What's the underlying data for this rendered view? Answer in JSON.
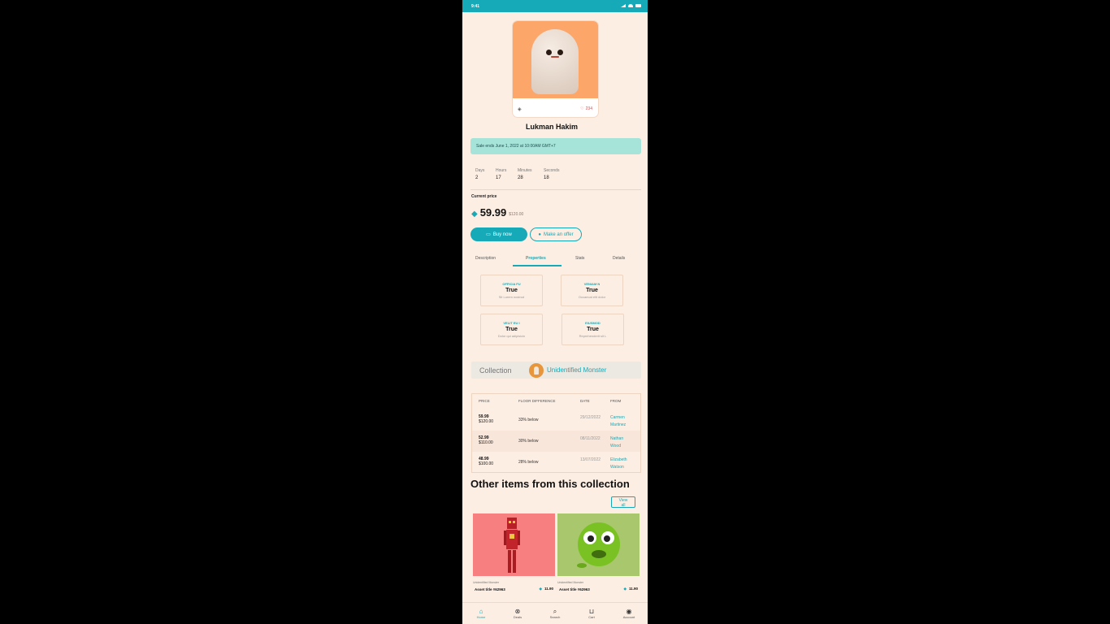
{
  "status_bar": {
    "time": "9:41"
  },
  "item": {
    "likes": "234",
    "name": "Lukman Hakim"
  },
  "sale": {
    "text": "Sale ends June 1, 2022 at 10:00AM GMT+7"
  },
  "countdown": [
    {
      "label": "Days",
      "value": "2"
    },
    {
      "label": "Hours",
      "value": "17"
    },
    {
      "label": "Minutes",
      "value": "28"
    },
    {
      "label": "Seconds",
      "value": "18"
    }
  ],
  "price": {
    "label": "Current price",
    "value": "59.99",
    "usd": "$120.00"
  },
  "buttons": {
    "buy": "Buy now",
    "offer": "Make an offer"
  },
  "tabs": [
    {
      "label": "Description"
    },
    {
      "label": "Properties"
    },
    {
      "label": "Stats"
    },
    {
      "label": "Details"
    }
  ],
  "properties": [
    {
      "key": "OFFICIA FU",
      "value": "True",
      "sub": "Sit Lorem nostrud"
    },
    {
      "key": "VENIAM N",
      "value": "True",
      "sub": "Occaecat elit dolor"
    },
    {
      "key": "VELIT EU I",
      "value": "True",
      "sub": "Dolor qui adipisicin"
    },
    {
      "key": "EIUSMOD",
      "value": "True",
      "sub": "Reprehenderit sit L"
    }
  ],
  "collection": {
    "label": "Collection",
    "name": "Unidentified Monster"
  },
  "offers_table": {
    "headers": [
      "PRICE",
      "FLOOR DIFFERENCE",
      "DATE",
      "FROM"
    ],
    "rows": [
      {
        "price": "59.99",
        "usd": "$120.00",
        "diff": "33% below",
        "date": "29/12/2022",
        "from": "Carmen Martinez"
      },
      {
        "price": "52.99",
        "usd": "$110.00",
        "diff": "30% below",
        "date": "08/11/2022",
        "from": "Nathan Wood"
      },
      {
        "price": "48.99",
        "usd": "$100.00",
        "diff": "28% below",
        "date": "13/07/2022",
        "from": "Elizabeth Watson"
      }
    ]
  },
  "other_items": {
    "title": "Other items from this collection",
    "view_all": "View all",
    "cards": [
      {
        "collection": "Unidentified Monster",
        "title": "Asset title #62963",
        "price": "11.90",
        "bg": "#f77f7f"
      },
      {
        "collection": "Unidentified Monster",
        "title": "Asset title #62963",
        "price": "11.90",
        "bg": "#a9c86d"
      }
    ]
  },
  "bottom_nav": [
    {
      "label": "Home",
      "icon": "home-icon",
      "active": true
    },
    {
      "label": "Deals",
      "icon": "deals-icon",
      "active": false
    },
    {
      "label": "Search",
      "icon": "search-icon",
      "active": false
    },
    {
      "label": "Cart",
      "icon": "cart-icon",
      "active": false
    },
    {
      "label": "Account",
      "icon": "account-icon",
      "active": false
    }
  ],
  "colors": {
    "accent": "#16a9b7",
    "background": "#fdeee3"
  }
}
